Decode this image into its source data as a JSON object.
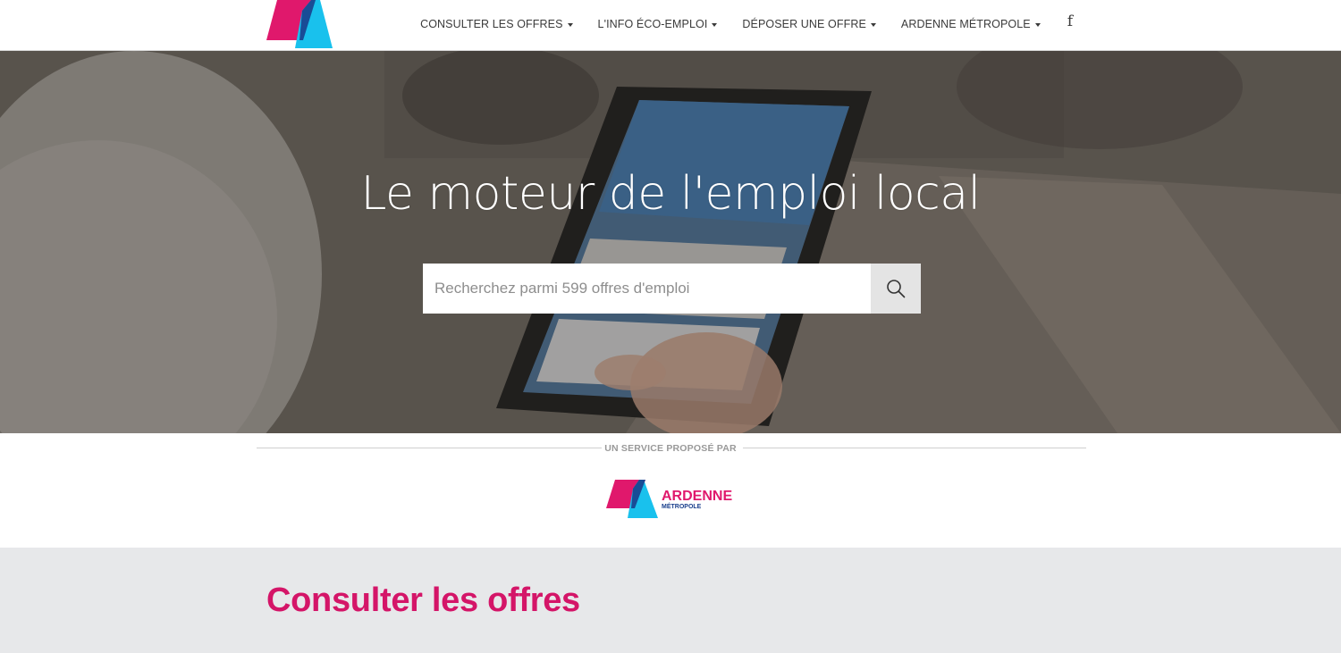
{
  "brand": {
    "pink": "#e0186c",
    "cyan": "#19c1ed",
    "accent": "#d41568"
  },
  "nav": {
    "items": [
      {
        "label": "CONSULTER LES OFFRES",
        "dropdown": true
      },
      {
        "label": "L'INFO ÉCO-EMPLOI",
        "dropdown": true
      },
      {
        "label": "DÉPOSER UNE OFFRE",
        "dropdown": true
      },
      {
        "label": "ARDENNE MÉTROPOLE",
        "dropdown": true
      }
    ],
    "social_icon": "facebook-icon",
    "social_glyph": "f"
  },
  "hero": {
    "title": "Le moteur de l'emploi local",
    "search": {
      "placeholder": "Recherchez parmi 599 offres d'emploi",
      "value": "",
      "icon": "search-icon"
    }
  },
  "service": {
    "label": "UN SERVICE PROPOSÉ PAR",
    "logo_text": "ARDENNE",
    "logo_subtext": "MÉTROPOLE"
  },
  "offers": {
    "title": "Consulter les offres"
  }
}
